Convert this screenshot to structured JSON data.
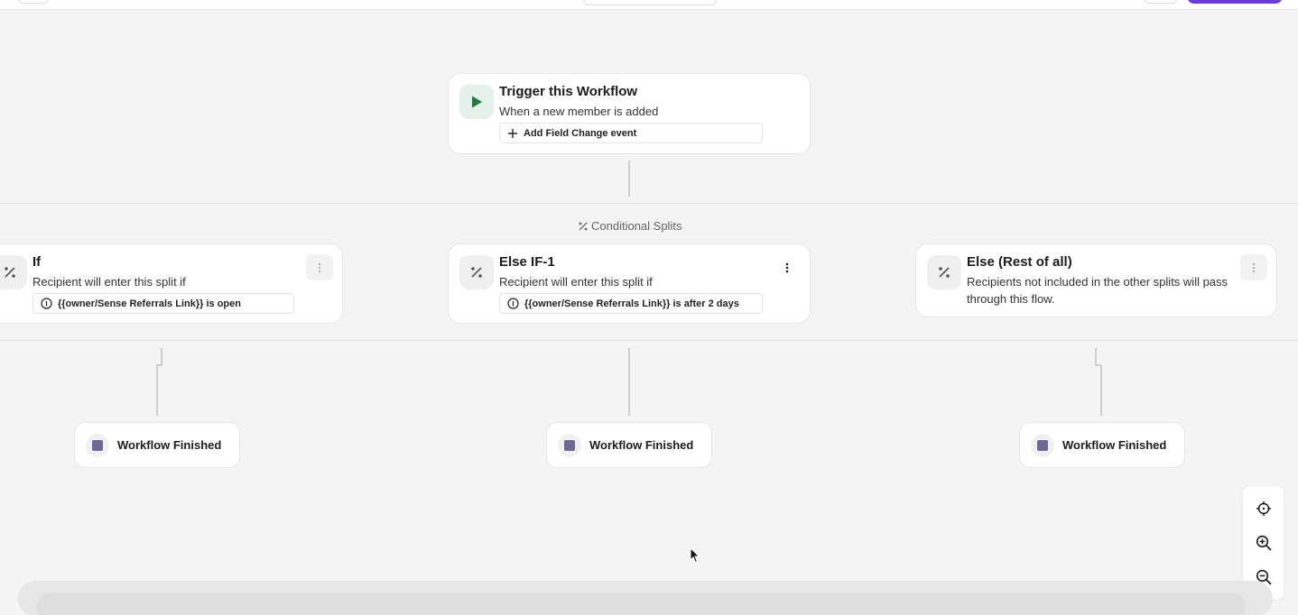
{
  "trigger": {
    "title": "Trigger this Workflow",
    "subtitle": "When a new member is added",
    "add_event_label": "Add Field Change event",
    "icon": "play-icon"
  },
  "splits": {
    "section_label": "Conditional Splits",
    "if": {
      "title": "If",
      "subtitle": "Recipient will enter this split if",
      "condition": "{{owner/Sense Referrals Link}} is open"
    },
    "else_if": {
      "title": "Else IF-1",
      "subtitle": "Recipient will enter this split if",
      "condition": "{{owner/Sense Referrals Link}} is after 2 days"
    },
    "else": {
      "title": "Else (Rest of all)",
      "subtitle_line1": "Recipients not included in the other splits will pass",
      "subtitle_line2": "through this flow."
    }
  },
  "finished": {
    "left": "Workflow Finished",
    "center": "Workflow Finished",
    "right": "Workflow Finished"
  },
  "zoom_controls": [
    "recenter-icon",
    "zoom-in-icon",
    "zoom-out-icon"
  ],
  "colors": {
    "accent": "#6b3bd6",
    "trigger_green": "#1f7a3f",
    "finish_square": "#6c6a94",
    "canvas_bg": "#f4f4f4"
  }
}
